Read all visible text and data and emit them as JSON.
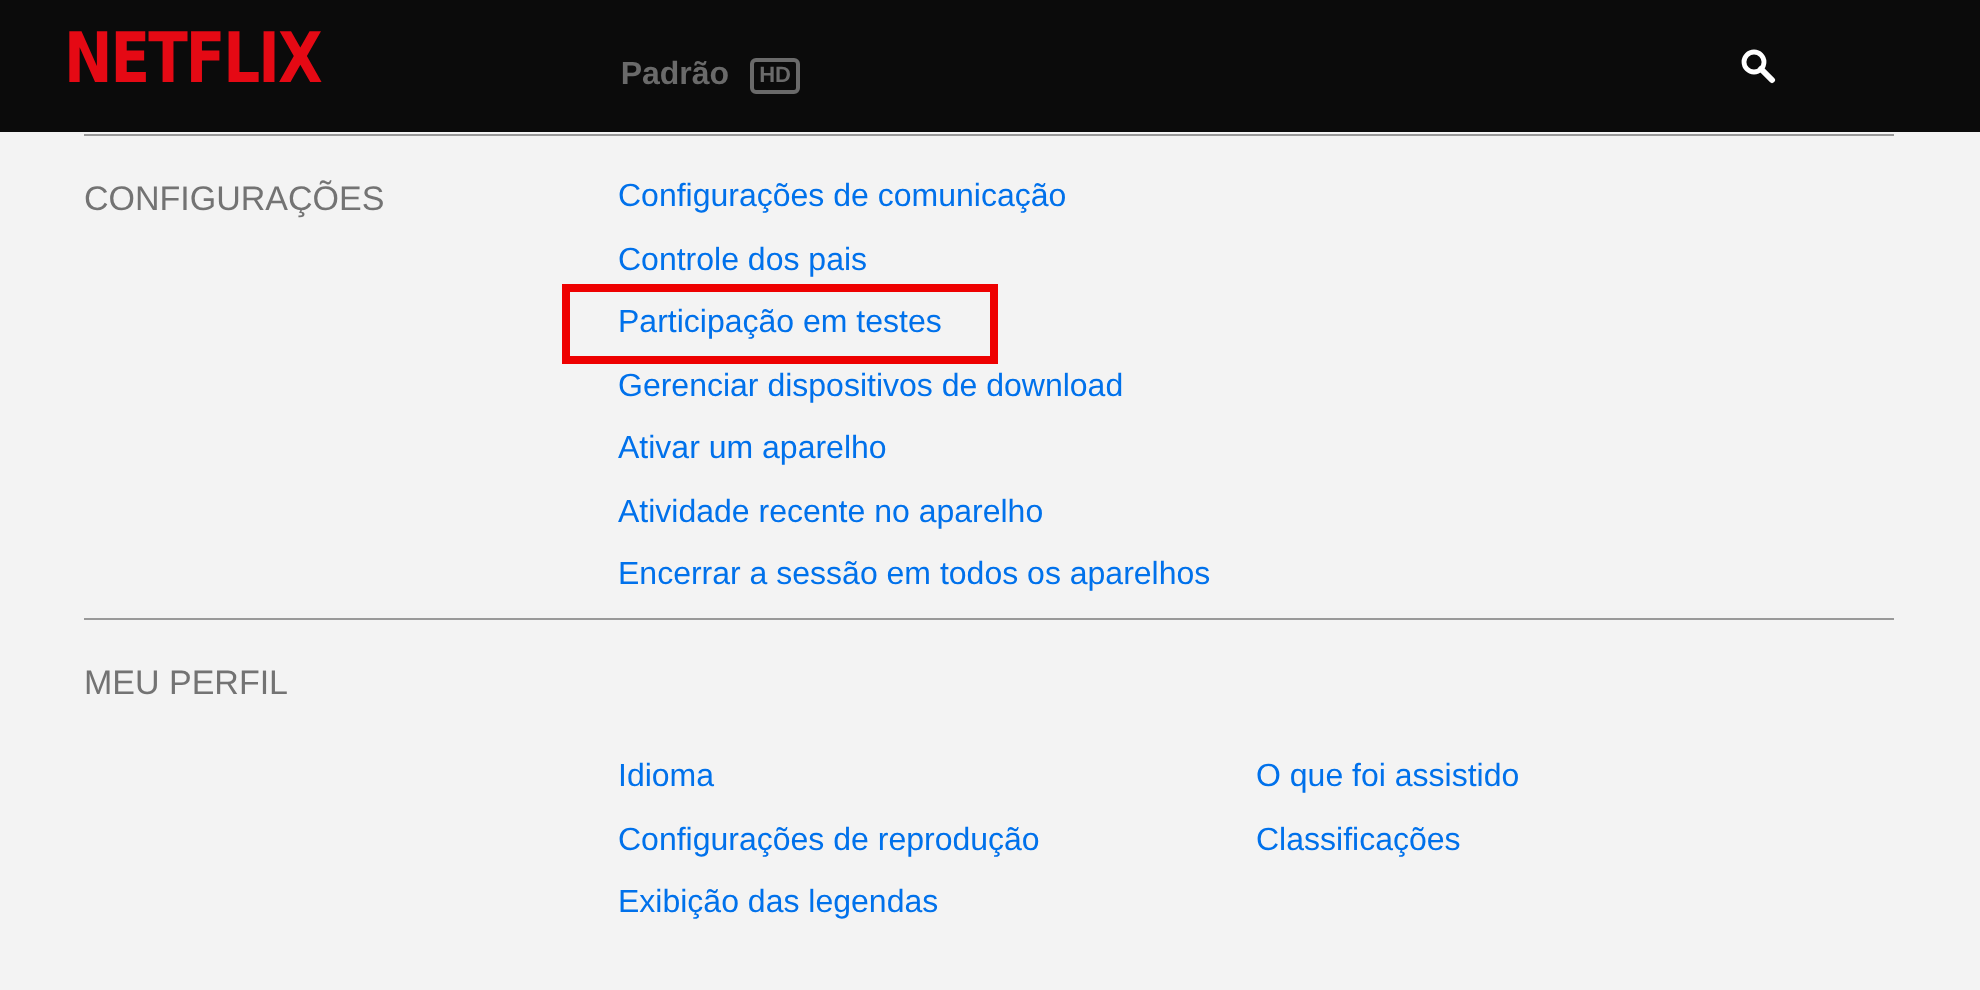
{
  "header": {
    "logo": "NETFLIX",
    "plan": "Padrão",
    "plan_badge": "HD"
  },
  "sections": [
    {
      "title": "CONFIGURAÇÕES",
      "columns": [
        [
          {
            "label": "Configurações de comunicação",
            "highlighted": false
          },
          {
            "label": "Controle dos pais",
            "highlighted": false
          },
          {
            "label": "Participação em testes",
            "highlighted": true
          },
          {
            "label": "Gerenciar dispositivos de download",
            "highlighted": false
          },
          {
            "label": "Ativar um aparelho",
            "highlighted": false
          },
          {
            "label": "Atividade recente no aparelho",
            "highlighted": false
          },
          {
            "label": "Encerrar a sessão em todos os aparelhos",
            "highlighted": false
          }
        ]
      ]
    },
    {
      "title": "MEU PERFIL",
      "columns": [
        [
          {
            "label": "Idioma",
            "highlighted": false
          },
          {
            "label": "Configurações de reprodução",
            "highlighted": false
          },
          {
            "label": "Exibição das legendas",
            "highlighted": false
          }
        ],
        [
          {
            "label": "O que foi assistido",
            "highlighted": false
          },
          {
            "label": "Classificações",
            "highlighted": false
          }
        ]
      ]
    }
  ]
}
